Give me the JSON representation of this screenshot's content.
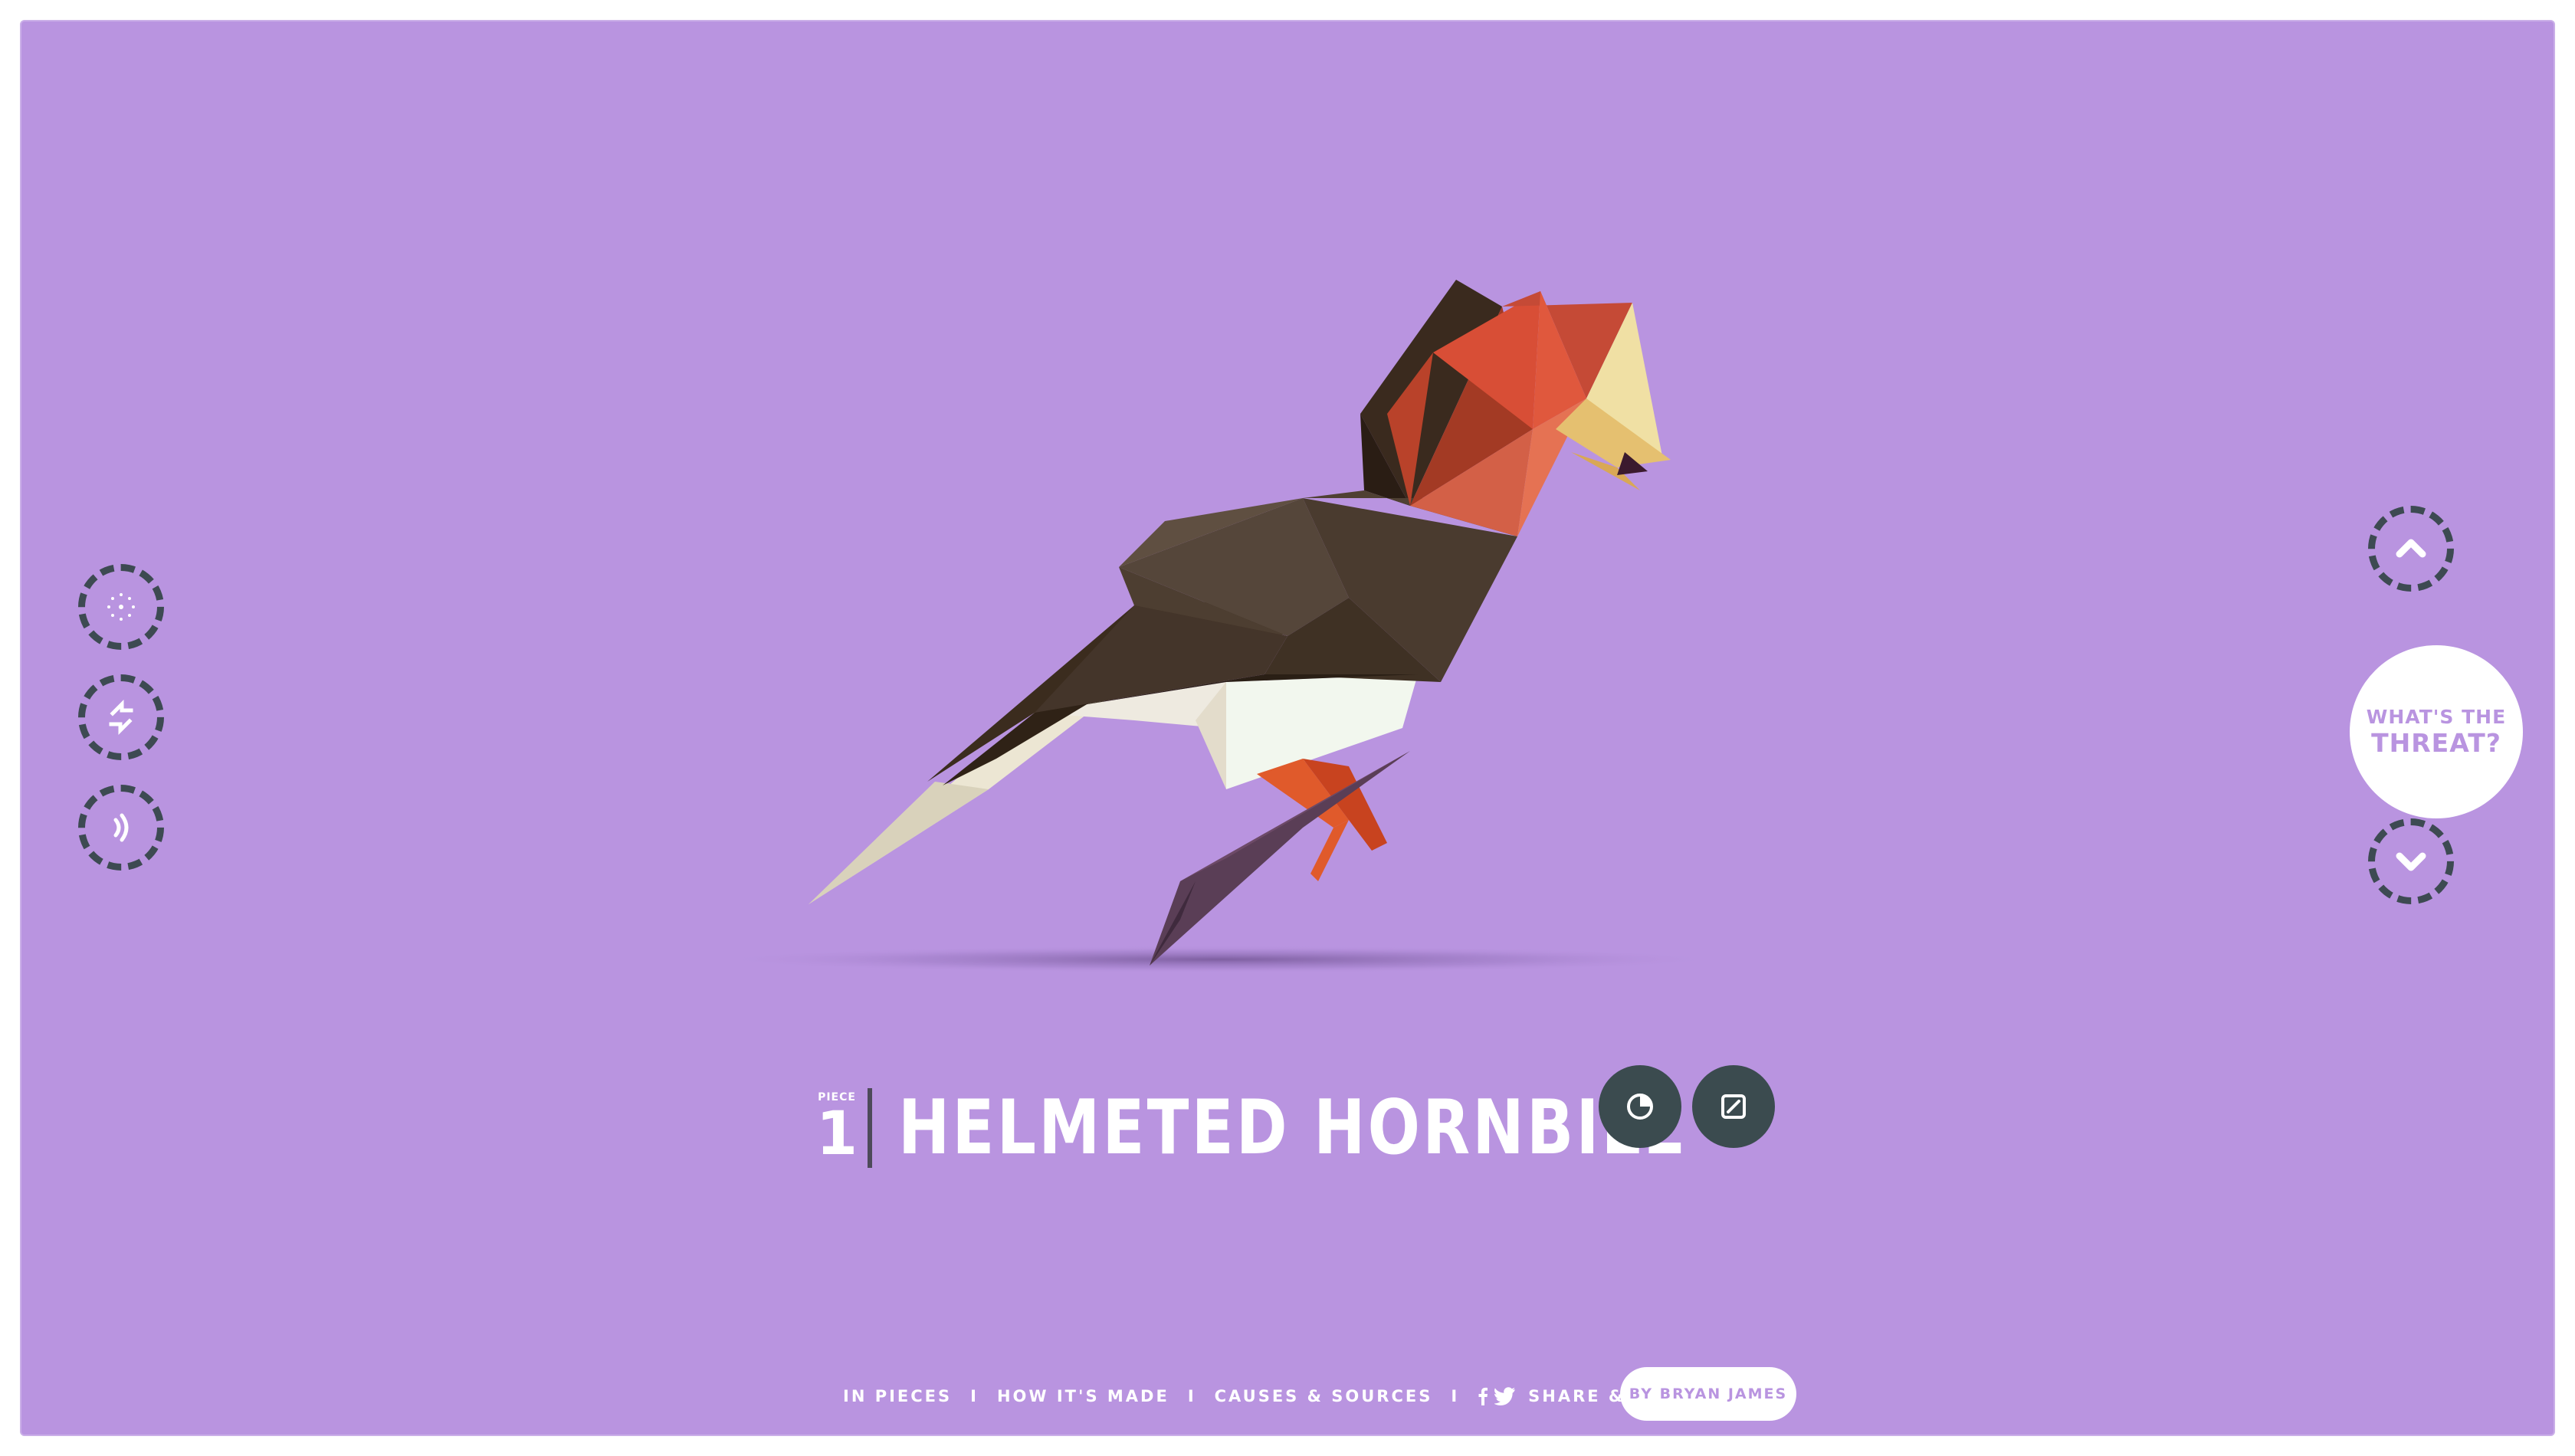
{
  "colors": {
    "background": "#b994e0",
    "frame": "#ffffff",
    "button_ring": "#3d4a52",
    "title_button": "#3b4b4f",
    "text": "#ffffff",
    "accent_text": "#b994e0"
  },
  "left_controls": [
    {
      "name": "dots-icon"
    },
    {
      "name": "shuffle-arrows-icon"
    },
    {
      "name": "sound-waves-icon"
    }
  ],
  "right_controls": {
    "up_icon": "chevron-up-icon",
    "down_icon": "chevron-down-icon",
    "threat_line1": "WHAT'S THE",
    "threat_line2": "THREAT?"
  },
  "title": {
    "piece_label": "PIECE",
    "piece_number": "1",
    "animal_name": "HELMETED HORNBILL",
    "buttons": [
      "info-circle-icon",
      "edit-square-icon"
    ]
  },
  "footer": {
    "links": [
      "IN PIECES",
      "HOW IT'S MADE",
      "CAUSES & SOURCES",
      "SHARE & POSTER"
    ],
    "separator": "I",
    "social_icons": [
      "facebook-icon",
      "twitter-icon"
    ],
    "byline": "BY BRYAN JAMES"
  }
}
